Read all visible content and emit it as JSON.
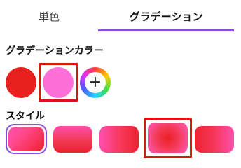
{
  "tabs": {
    "solid_label": "単色",
    "gradient_label": "グラデーション",
    "active": "gradient",
    "accent_color": "#8b4fe0"
  },
  "gradient_colors": {
    "title": "グラデーションカラー",
    "swatches": [
      {
        "name": "red",
        "color": "#e8211f"
      },
      {
        "name": "pink",
        "color": "#ff6fd8",
        "highlighted": true
      },
      {
        "name": "add-color",
        "icon": "plus-icon",
        "glyph": "+"
      }
    ]
  },
  "styles": {
    "title": "スタイル",
    "tiles": [
      {
        "name": "diagonal",
        "selected": true
      },
      {
        "name": "vertical"
      },
      {
        "name": "horizontal"
      },
      {
        "name": "radial",
        "highlighted": true
      },
      {
        "name": "horizontal-reverse"
      }
    ]
  },
  "highlight_color": "#e0140f"
}
